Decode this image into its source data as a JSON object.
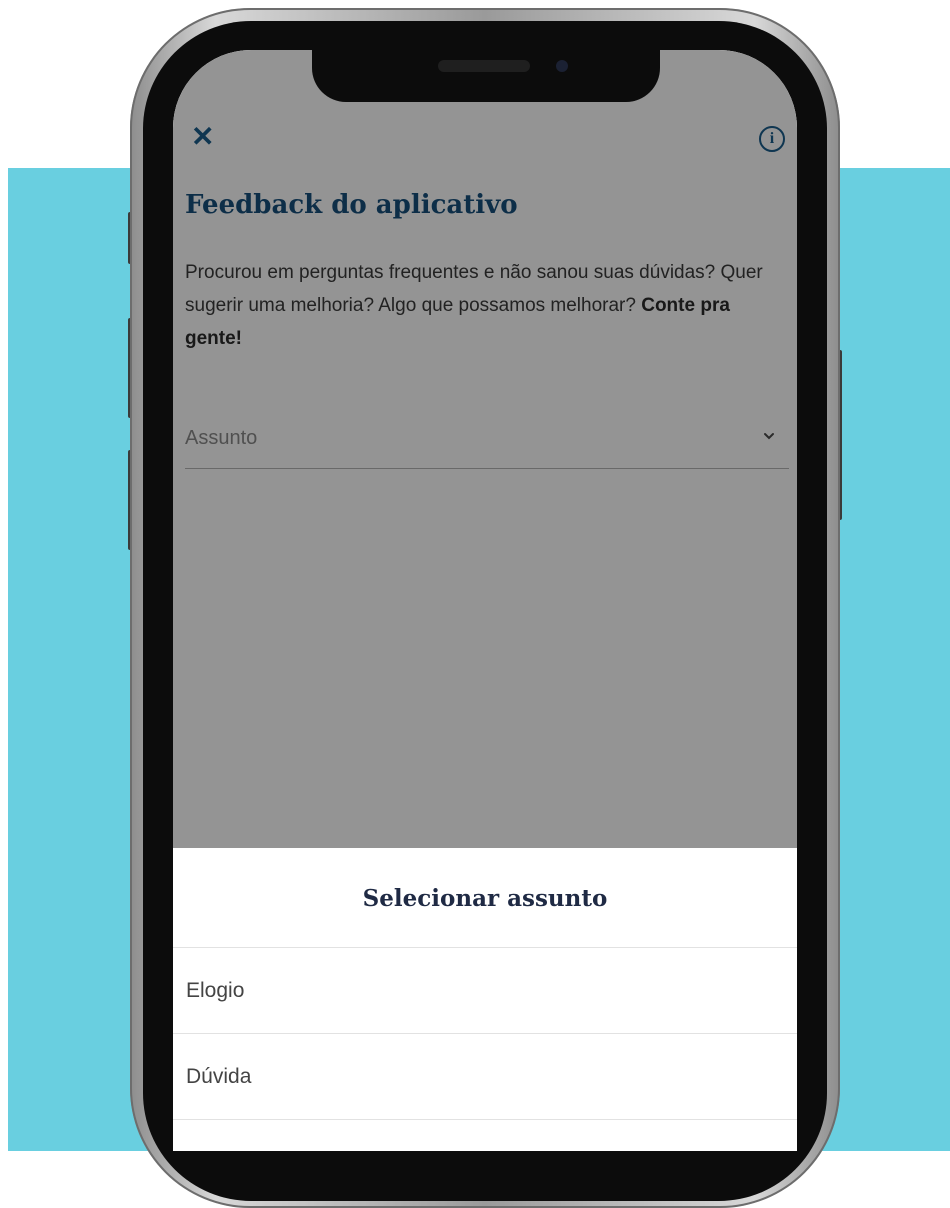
{
  "colors": {
    "background_band": "#69cfe0",
    "primary_text": "#17507d",
    "sheet_title": "#1f2a44",
    "overlay": "rgba(0,0,0,0.42)"
  },
  "header": {
    "close_icon": "close-icon",
    "info_icon": "info-icon",
    "info_glyph": "i"
  },
  "page": {
    "title": "Feedback do aplicativo",
    "intro_text": "Procurou em perguntas frequentes e não sanou suas dúvidas? Quer sugerir uma melhoria? Algo que possamos melhorar?",
    "intro_emphasis": "Conte pra gente!"
  },
  "form": {
    "subject_label": "Assunto",
    "subject_icon": "chevron-down-icon"
  },
  "sheet": {
    "title": "Selecionar assunto",
    "options": [
      {
        "label": "Elogio"
      },
      {
        "label": "Dúvida"
      },
      {
        "label": ""
      }
    ]
  }
}
